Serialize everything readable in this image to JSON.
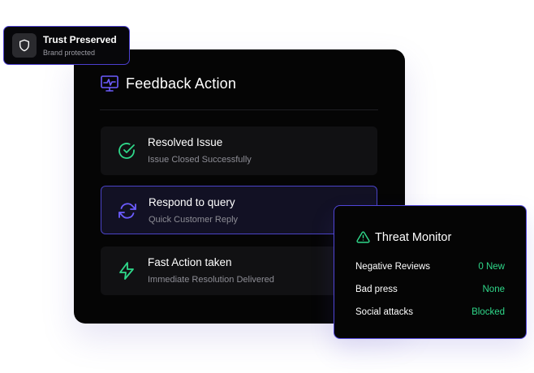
{
  "trust_badge": {
    "title": "Trust Preserved",
    "subtitle": "Brand protected",
    "icon": "shield-icon"
  },
  "feedback": {
    "title": "Feedback Action",
    "icon": "monitor-pulse-icon",
    "accent": "#6c5cff",
    "items": [
      {
        "title": "Resolved Issue",
        "subtitle": "Issue Closed Successfully",
        "icon": "check-circle-icon",
        "icon_color": "#2fd88a"
      },
      {
        "title": "Respond to query",
        "subtitle": "Quick Customer Reply",
        "icon": "refresh-icon",
        "icon_color": "#6c5cff"
      },
      {
        "title": "Fast Action taken",
        "subtitle": "Immediate Resolution Delivered",
        "icon": "lightning-icon",
        "icon_color": "#2fd88a"
      }
    ]
  },
  "threat_monitor": {
    "title": "Threat Monitor",
    "icon": "warning-triangle-icon",
    "rows": [
      {
        "label": "Negative Reviews",
        "value": "0 New"
      },
      {
        "label": "Bad press",
        "value": "None"
      },
      {
        "label": "Social attacks",
        "value": "Blocked"
      }
    ],
    "value_color": "#2fd88a"
  }
}
